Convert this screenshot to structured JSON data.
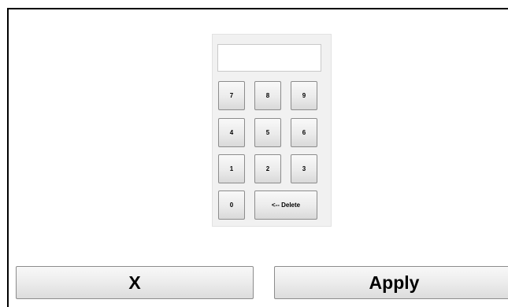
{
  "keypad": {
    "display_value": "",
    "keys": {
      "k7": "7",
      "k8": "8",
      "k9": "9",
      "k4": "4",
      "k5": "5",
      "k6": "6",
      "k1": "1",
      "k2": "2",
      "k3": "3",
      "k0": "0",
      "delete": "<-- Delete"
    }
  },
  "actions": {
    "cancel_label": "X",
    "apply_label": "Apply"
  }
}
